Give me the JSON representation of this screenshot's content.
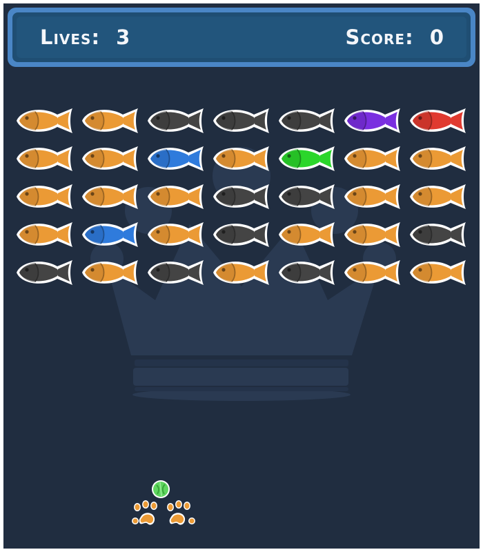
{
  "hud": {
    "lives_label": "Lives:",
    "lives_value": "3",
    "score_label": "Score:",
    "score_value": "0"
  },
  "colors": {
    "background": "#202d40",
    "hud_border": "#4a86c6",
    "hud_fill": "#22557c",
    "crown_watermark": "#2a3a52",
    "fish_outline": "#ffffff",
    "orange": "#eb9a35",
    "gray": "#444444",
    "blue": "#2f7bdc",
    "green": "#2bd62b",
    "purple": "#7a2fe0",
    "red": "#e03a30",
    "ball": "#5fd65f",
    "paw": "#eb9a35"
  },
  "bricks": {
    "icon": "fish-icon",
    "rows": [
      [
        "orange",
        "orange",
        "gray",
        "gray",
        "gray",
        "purple",
        "red"
      ],
      [
        "orange",
        "orange",
        "blue",
        "orange",
        "green",
        "orange",
        "orange"
      ],
      [
        "orange",
        "orange",
        "orange",
        "gray",
        "gray",
        "orange",
        "orange"
      ],
      [
        "orange",
        "blue",
        "orange",
        "gray",
        "orange",
        "orange",
        "gray"
      ],
      [
        "gray",
        "orange",
        "gray",
        "orange",
        "gray",
        "orange",
        "orange"
      ]
    ]
  },
  "ball": {
    "icon": "ball-icon"
  },
  "paddle": {
    "icon": "paw-prints-icon"
  },
  "background_decoration": {
    "icon": "crown-icon"
  }
}
